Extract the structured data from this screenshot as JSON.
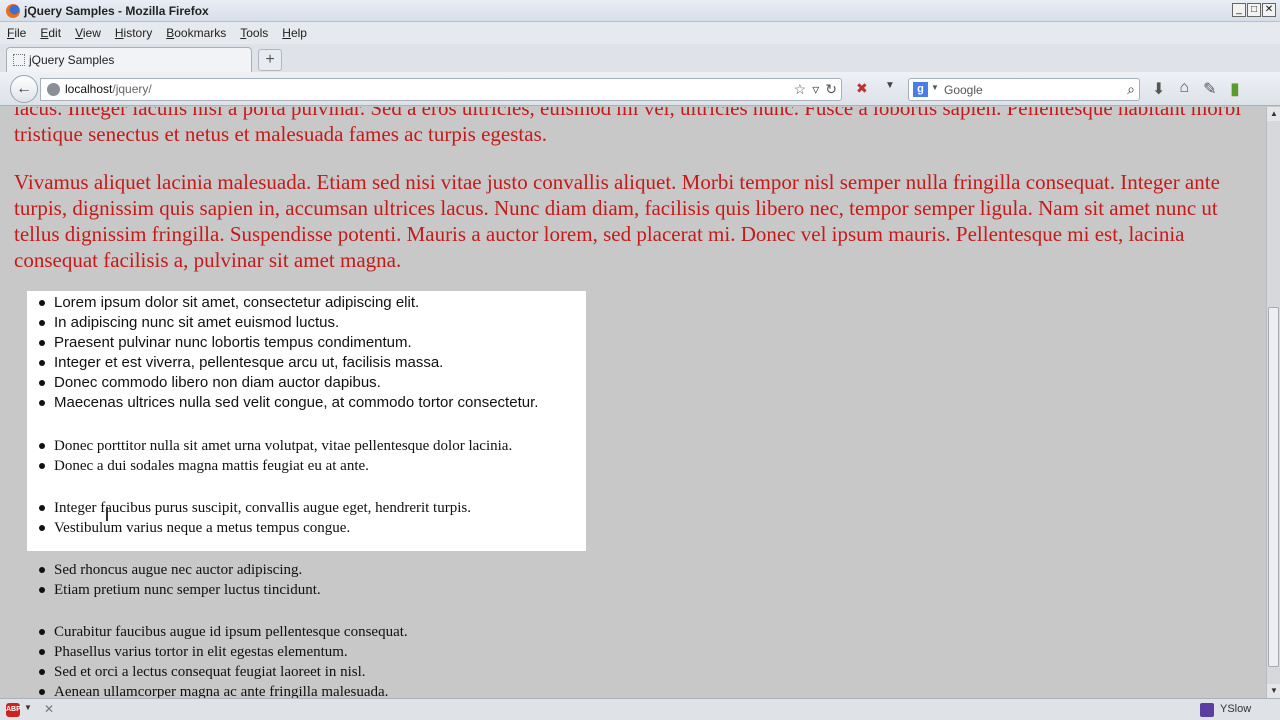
{
  "window": {
    "title": "jQuery Samples - Mozilla Firefox"
  },
  "menu": [
    "File",
    "Edit",
    "View",
    "History",
    "Bookmarks",
    "Tools",
    "Help"
  ],
  "tab": {
    "label": "jQuery Samples",
    "new_tab": "+"
  },
  "nav": {
    "url_host": "localhost",
    "url_path": "/jquery/",
    "search_placeholder": "Google",
    "search_engine_letter": "g"
  },
  "content": {
    "para1": "lacus. Integer iaculis nisi a porta pulvinar. Sed a eros ultricies, euismod mi vel, ultricies nunc. Fusce a lobortis sapien. Pellentesque habitant morbi tristique senectus et netus et malesuada fames ac turpis egestas.",
    "para2": "Vivamus aliquet lacinia malesuada. Etiam sed nisi vitae justo convallis aliquet. Morbi tempor nisl semper nulla fringilla consequat. Integer ante turpis, dignissim quis sapien in, accumsan ultrices lacus. Nunc diam diam, facilisis quis libero nec, tempor semper ligula. Nam sit amet nunc ut tellus dignissim fringilla. Suspendisse potenti. Mauris a auctor lorem, sed placerat mi. Donec vel ipsum mauris. Pellentesque mi est, lacinia consequat facilisis a, pulvinar sit amet magna.",
    "list1": [
      "Lorem ipsum dolor sit amet, consectetur adipiscing elit.",
      "In adipiscing nunc sit amet euismod luctus.",
      "Praesent pulvinar nunc lobortis tempus condimentum.",
      "Integer et est viverra, pellentesque arcu ut, facilisis massa.",
      "Donec commodo libero non diam auctor dapibus.",
      "Maecenas ultrices nulla sed velit congue, at commodo tortor consectetur."
    ],
    "list2": [
      "Donec porttitor nulla sit amet urna volutpat, vitae pellentesque dolor lacinia.",
      "Donec a dui sodales magna mattis feugiat eu at ante."
    ],
    "list3": [
      "Integer faucibus purus suscipit, convallis augue eget, hendrerit turpis.",
      "Vestibulum varius neque a metus tempus congue."
    ],
    "list4": [
      "Sed rhoncus augue nec auctor adipiscing.",
      "Etiam pretium nunc semper luctus tincidunt."
    ],
    "list5": [
      "Curabitur faucibus augue id ipsum pellentesque consequat.",
      "Phasellus varius tortor in elit egestas elementum.",
      "Sed et orci a lectus consequat feugiat laoreet in nisl.",
      "Aenean ullamcorper magna ac ante fringilla malesuada."
    ]
  },
  "status": {
    "abp_label": "ABP",
    "yslow_label": "YSlow"
  },
  "colors": {
    "paragraph_text": "#c41a1a",
    "page_background": "#c8c8c8",
    "highlight_box": "#ffffff"
  }
}
